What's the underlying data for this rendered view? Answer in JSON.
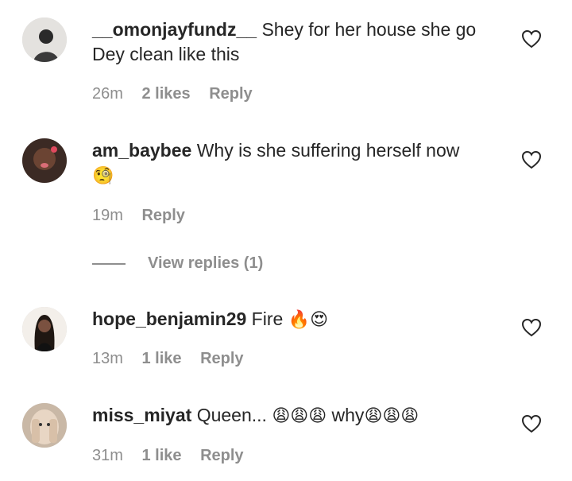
{
  "comments": [
    {
      "username": "__omonjayfundz__",
      "text": "Shey for her house she go Dey clean like this",
      "time": "26m",
      "likes": "2 likes",
      "reply": "Reply"
    },
    {
      "username": "am_baybee",
      "text": "Why is she suffering herself now",
      "emoji": "🧐",
      "time": "19m",
      "reply": "Reply"
    },
    {
      "username": "hope_benjamin29",
      "text": "Fire",
      "emoji": "🔥😍",
      "time": "13m",
      "likes": "1 like",
      "reply": "Reply"
    },
    {
      "username": "miss_miyat",
      "text": "Queen...",
      "emoji1": "😩😩😩",
      "text2": "why",
      "emoji2": "😩😩😩",
      "time": "31m",
      "likes": "1 like",
      "reply": "Reply"
    }
  ],
  "view_replies": "View replies (1)",
  "icons": {
    "like": "heart-outline-icon"
  },
  "colors": {
    "text": "#262626",
    "meta": "#8e8e8e"
  }
}
